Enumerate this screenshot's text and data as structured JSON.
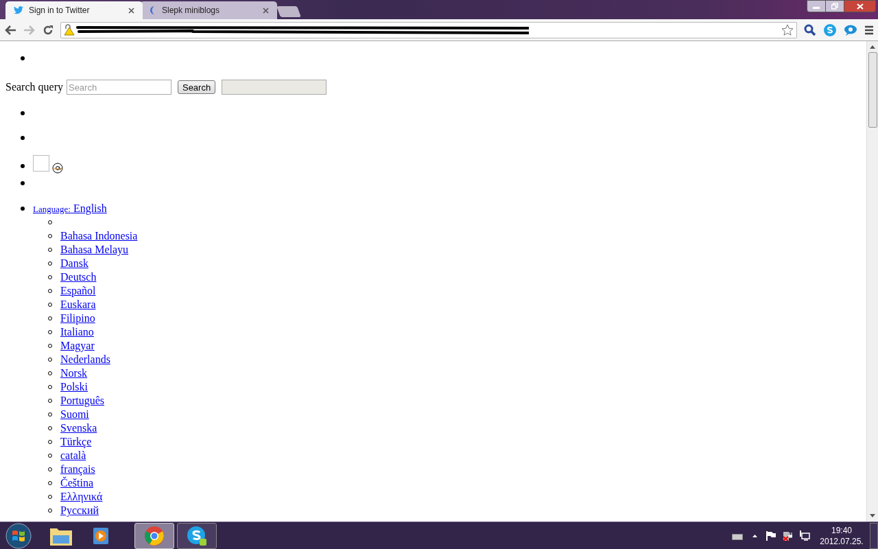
{
  "tabs": [
    {
      "title": "Sign in to Twitter",
      "kind": "bird",
      "selected": true
    },
    {
      "title": "Slepk miniblogs",
      "kind": "loading",
      "selected": false
    }
  ],
  "search": {
    "label": "Search query",
    "placeholder": "Search",
    "button": "Search"
  },
  "language": {
    "label": "Language:",
    "value": "English"
  },
  "languages": [
    "Bahasa Indonesia",
    "Bahasa Melayu",
    "Dansk",
    "Deutsch",
    "Español",
    "Euskara",
    "Filipino",
    "Italiano",
    "Magyar",
    "Nederlands",
    "Norsk",
    "Polski",
    "Português",
    "Suomi",
    "Svenska",
    "Türkçe",
    "català",
    "français",
    "Čeština",
    "Ελληνικά",
    "Русский"
  ],
  "clock": {
    "time": "19:40",
    "date": "2012.07.25."
  }
}
